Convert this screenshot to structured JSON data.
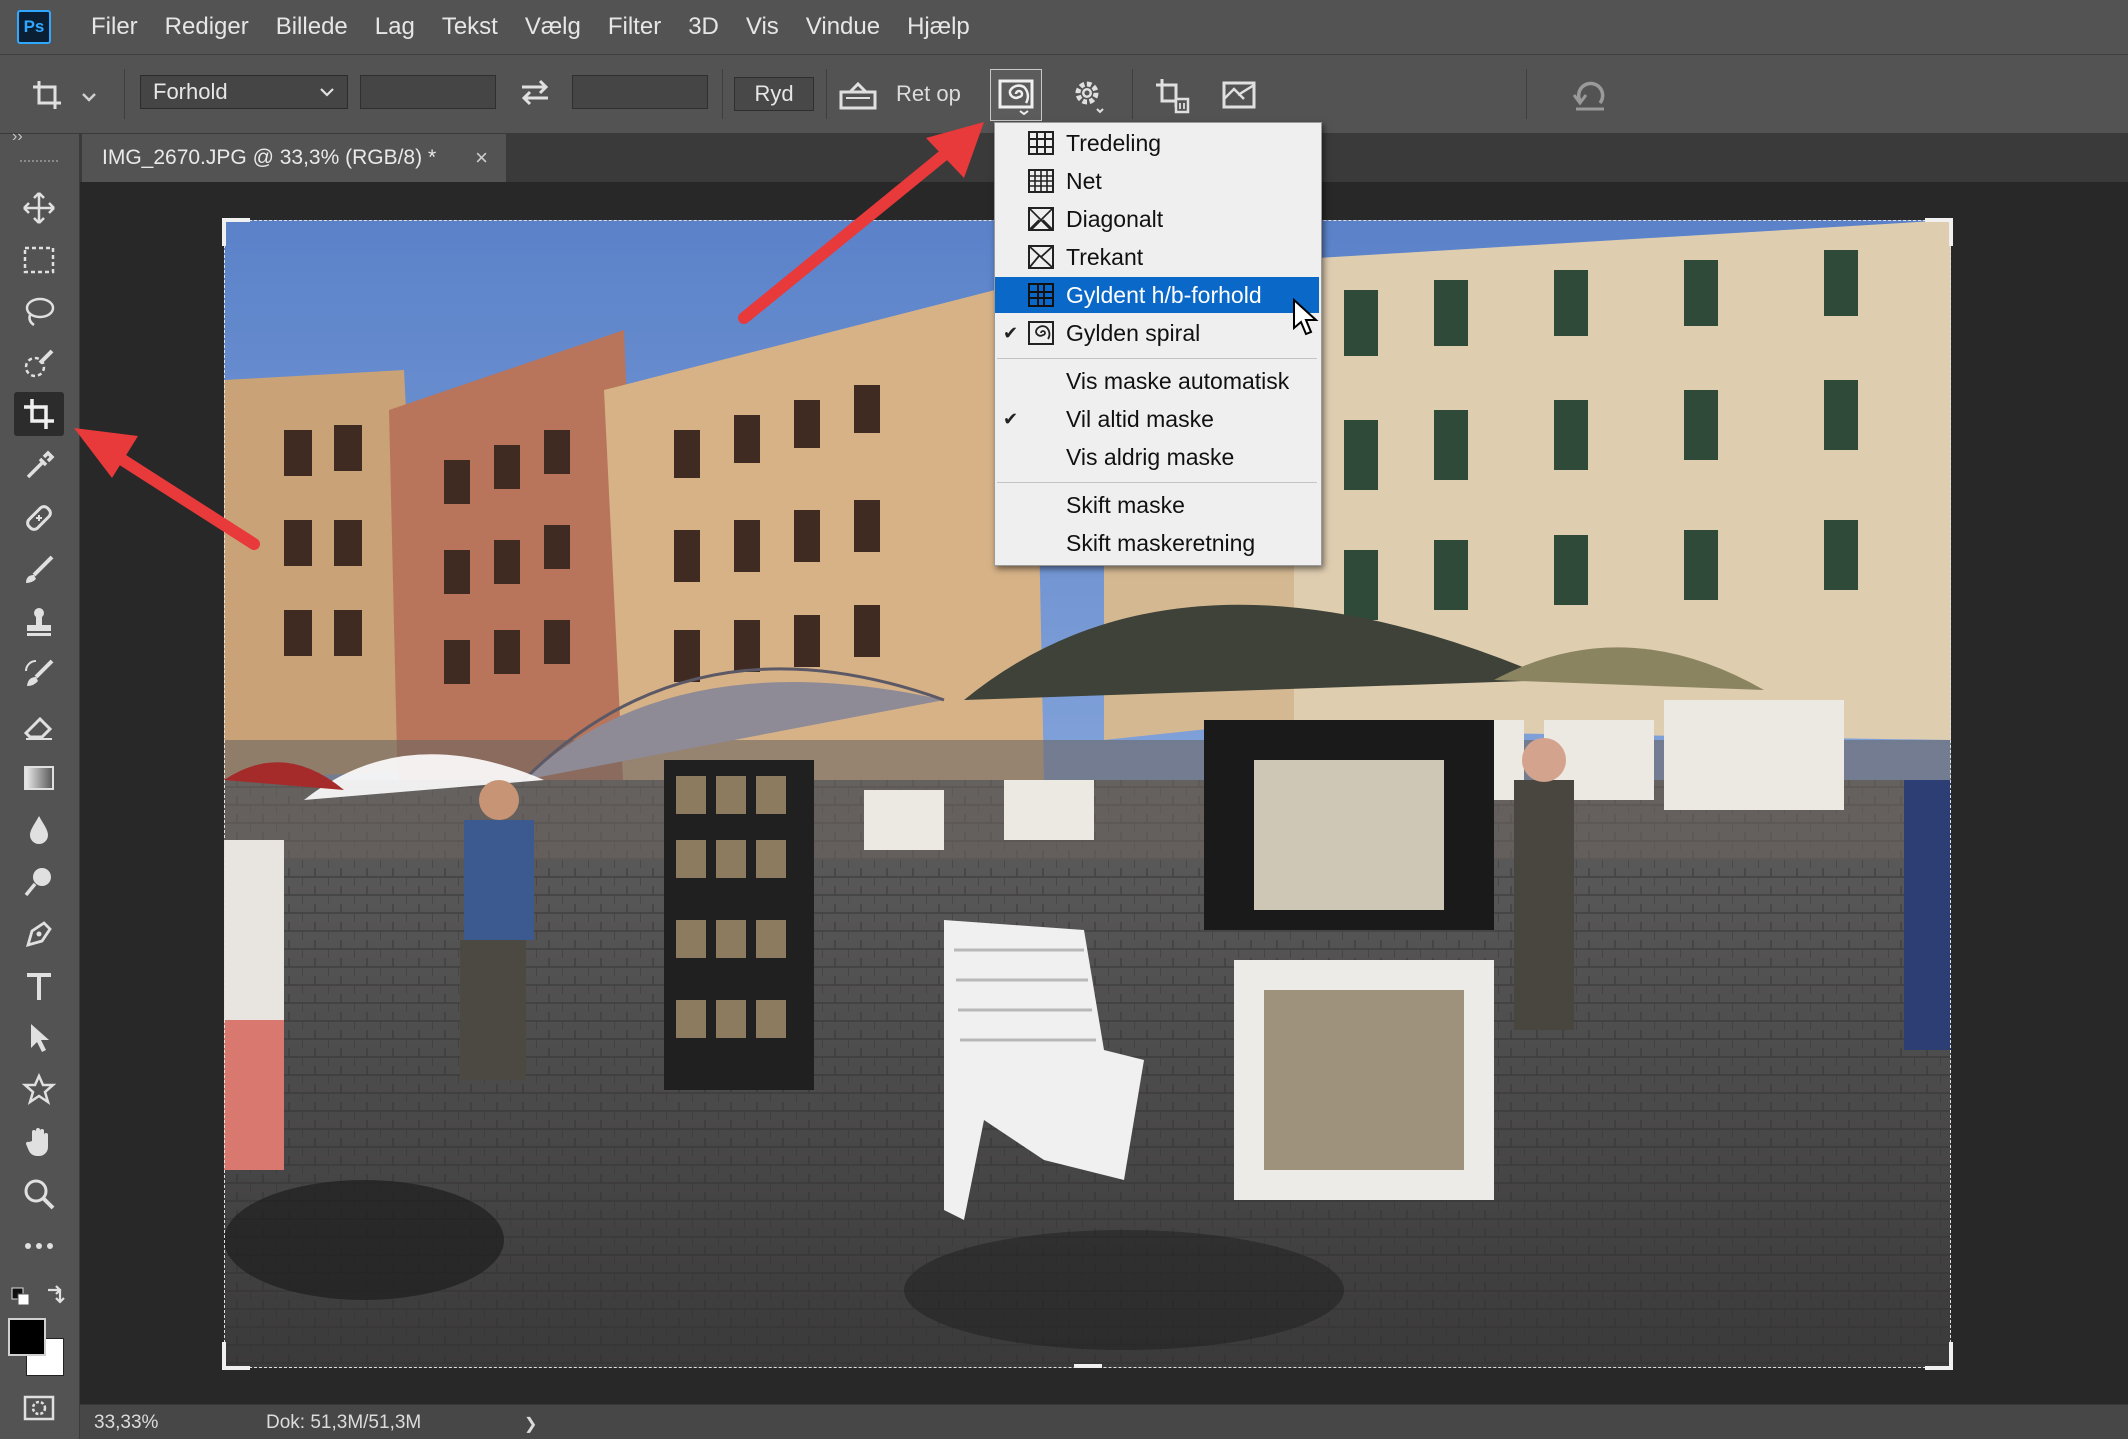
{
  "menubar": {
    "app_logo": "Ps",
    "items": [
      "Filer",
      "Rediger",
      "Billede",
      "Lag",
      "Tekst",
      "Vælg",
      "Filter",
      "3D",
      "Vis",
      "Vindue",
      "Hjælp"
    ]
  },
  "options_bar": {
    "ratio_select_value": "Forhold",
    "width_value": "",
    "height_value": "",
    "clear_label": "Ryd",
    "straighten_label": "Ret op"
  },
  "document": {
    "tab_title": "IMG_2670.JPG @ 33,3% (RGB/8) *",
    "close_glyph": "×"
  },
  "status_bar": {
    "zoom": "33,33%",
    "doc_size": "Dok: 51,3M/51,3M",
    "more_glyph": "❯"
  },
  "overlay_menu": {
    "items": [
      {
        "label": "Tredeling",
        "icon": "thirds-grid-icon",
        "checked": false,
        "highlighted": false
      },
      {
        "label": "Net",
        "icon": "grid-icon",
        "checked": false,
        "highlighted": false
      },
      {
        "label": "Diagonalt",
        "icon": "diagonal-icon",
        "checked": false,
        "highlighted": false
      },
      {
        "label": "Trekant",
        "icon": "triangle-icon",
        "checked": false,
        "highlighted": false
      },
      {
        "label": "Gyldent h/b-forhold",
        "icon": "golden-ratio-icon",
        "checked": false,
        "highlighted": true
      },
      {
        "label": "Gylden spiral",
        "icon": "golden-spiral-icon",
        "checked": true,
        "highlighted": false
      }
    ],
    "mask_items": [
      {
        "label": "Vis maske automatisk",
        "checked": false
      },
      {
        "label": "Vil altid maske",
        "checked": true
      },
      {
        "label": "Vis aldrig maske",
        "checked": false
      }
    ],
    "cycle_items": [
      {
        "label": "Skift maske"
      },
      {
        "label": "Skift maskeretning"
      }
    ]
  },
  "colors": {
    "accent_highlight": "#0a68c8",
    "annotation_arrow": "#e8393b",
    "ps_blue": "#31a8ff"
  }
}
